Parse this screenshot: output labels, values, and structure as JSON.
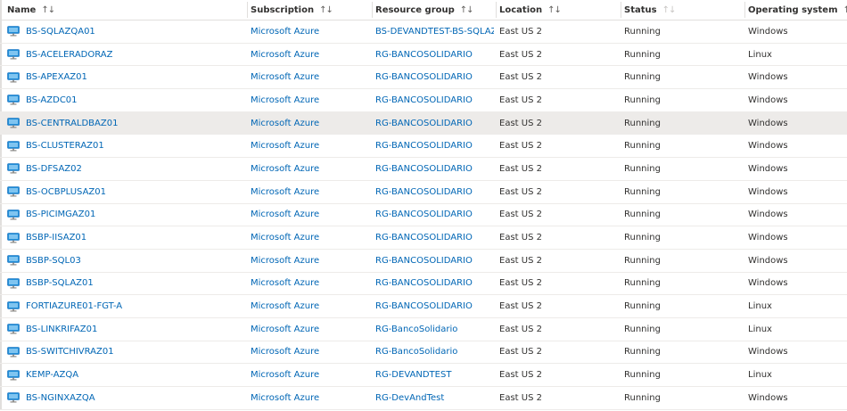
{
  "columns": [
    {
      "label": "Name",
      "sort_icon": "↑↓"
    },
    {
      "label": "Subscription",
      "sort_icon": "↑↓"
    },
    {
      "label": "Resource group",
      "sort_icon": "↑↓"
    },
    {
      "label": "Location",
      "sort_icon": "↑↓"
    },
    {
      "label": "Status",
      "sort_icon": "↑↓"
    },
    {
      "label": "Operating system",
      "sort_icon": "↑↓"
    }
  ],
  "colors": {
    "link": "#0066b5",
    "vm_icon": "#1f8cd6",
    "selected_row": "#edebe9"
  },
  "rows": [
    {
      "name": "BS-SQLAZQA01",
      "subscription": "Microsoft Azure",
      "resource_group": "BS-DEVANDTEST-BS-SQLAZ...",
      "location": "East US 2",
      "status": "Running",
      "os": "Windows"
    },
    {
      "name": "BS-ACELERADORAZ",
      "subscription": "Microsoft Azure",
      "resource_group": "RG-BANCOSOLIDARIO",
      "location": "East US 2",
      "status": "Running",
      "os": "Linux"
    },
    {
      "name": "BS-APEXAZ01",
      "subscription": "Microsoft Azure",
      "resource_group": "RG-BANCOSOLIDARIO",
      "location": "East US 2",
      "status": "Running",
      "os": "Windows"
    },
    {
      "name": "BS-AZDC01",
      "subscription": "Microsoft Azure",
      "resource_group": "RG-BANCOSOLIDARIO",
      "location": "East US 2",
      "status": "Running",
      "os": "Windows"
    },
    {
      "name": "BS-CENTRALDBAZ01",
      "subscription": "Microsoft Azure",
      "resource_group": "RG-BANCOSOLIDARIO",
      "location": "East US 2",
      "status": "Running",
      "os": "Windows",
      "selected": true
    },
    {
      "name": "BS-CLUSTERAZ01",
      "subscription": "Microsoft Azure",
      "resource_group": "RG-BANCOSOLIDARIO",
      "location": "East US 2",
      "status": "Running",
      "os": "Windows"
    },
    {
      "name": "BS-DFSAZ02",
      "subscription": "Microsoft Azure",
      "resource_group": "RG-BANCOSOLIDARIO",
      "location": "East US 2",
      "status": "Running",
      "os": "Windows"
    },
    {
      "name": "BS-OCBPLUSAZ01",
      "subscription": "Microsoft Azure",
      "resource_group": "RG-BANCOSOLIDARIO",
      "location": "East US 2",
      "status": "Running",
      "os": "Windows"
    },
    {
      "name": "BS-PICIMGAZ01",
      "subscription": "Microsoft Azure",
      "resource_group": "RG-BANCOSOLIDARIO",
      "location": "East US 2",
      "status": "Running",
      "os": "Windows"
    },
    {
      "name": "BSBP-IISAZ01",
      "subscription": "Microsoft Azure",
      "resource_group": "RG-BANCOSOLIDARIO",
      "location": "East US 2",
      "status": "Running",
      "os": "Windows"
    },
    {
      "name": "BSBP-SQL03",
      "subscription": "Microsoft Azure",
      "resource_group": "RG-BANCOSOLIDARIO",
      "location": "East US 2",
      "status": "Running",
      "os": "Windows"
    },
    {
      "name": "BSBP-SQLAZ01",
      "subscription": "Microsoft Azure",
      "resource_group": "RG-BANCOSOLIDARIO",
      "location": "East US 2",
      "status": "Running",
      "os": "Windows"
    },
    {
      "name": "FORTIAZURE01-FGT-A",
      "subscription": "Microsoft Azure",
      "resource_group": "RG-BANCOSOLIDARIO",
      "location": "East US 2",
      "status": "Running",
      "os": "Linux"
    },
    {
      "name": "BS-LINKRIFAZ01",
      "subscription": "Microsoft Azure",
      "resource_group": "RG-BancoSolidario",
      "location": "East US 2",
      "status": "Running",
      "os": "Linux"
    },
    {
      "name": "BS-SWITCHIVRAZ01",
      "subscription": "Microsoft Azure",
      "resource_group": "RG-BancoSolidario",
      "location": "East US 2",
      "status": "Running",
      "os": "Windows"
    },
    {
      "name": "KEMP-AZQA",
      "subscription": "Microsoft Azure",
      "resource_group": "RG-DEVANDTEST",
      "location": "East US 2",
      "status": "Running",
      "os": "Linux"
    },
    {
      "name": "BS-NGINXAZQA",
      "subscription": "Microsoft Azure",
      "resource_group": "RG-DevAndTest",
      "location": "East US 2",
      "status": "Running",
      "os": "Windows"
    }
  ]
}
